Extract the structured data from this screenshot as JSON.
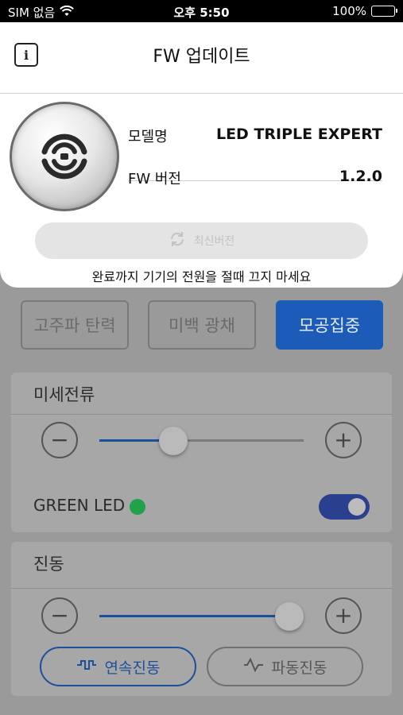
{
  "status_bar": {
    "carrier": "SIM 없음",
    "time": "오후 5:50",
    "battery": "100%"
  },
  "modal": {
    "title": "FW 업데이트",
    "model_label": "모델명",
    "model_value": "LED TRIPLE EXPERT",
    "fw_label": "FW 버전",
    "fw_value": "1.2.0",
    "latest_button": "최신버전",
    "warning": "완료까지 기기의 전원을 절때 끄지 마세요"
  },
  "background": {
    "modes": [
      {
        "label": "고주파 탄력",
        "active": false
      },
      {
        "label": "미백 광채",
        "active": false
      },
      {
        "label": "모공집중",
        "active": true
      }
    ],
    "microcurrent": {
      "title": "미세전류",
      "level": 0.36
    },
    "green_led": {
      "label": "GREEN LED",
      "on": true
    },
    "vibration": {
      "title": "진동",
      "level": 0.93,
      "continuous_label": "연속진동",
      "wave_label": "파동진동"
    }
  },
  "colors": {
    "accent": "#1c5bb8",
    "green": "#1fa24a"
  }
}
